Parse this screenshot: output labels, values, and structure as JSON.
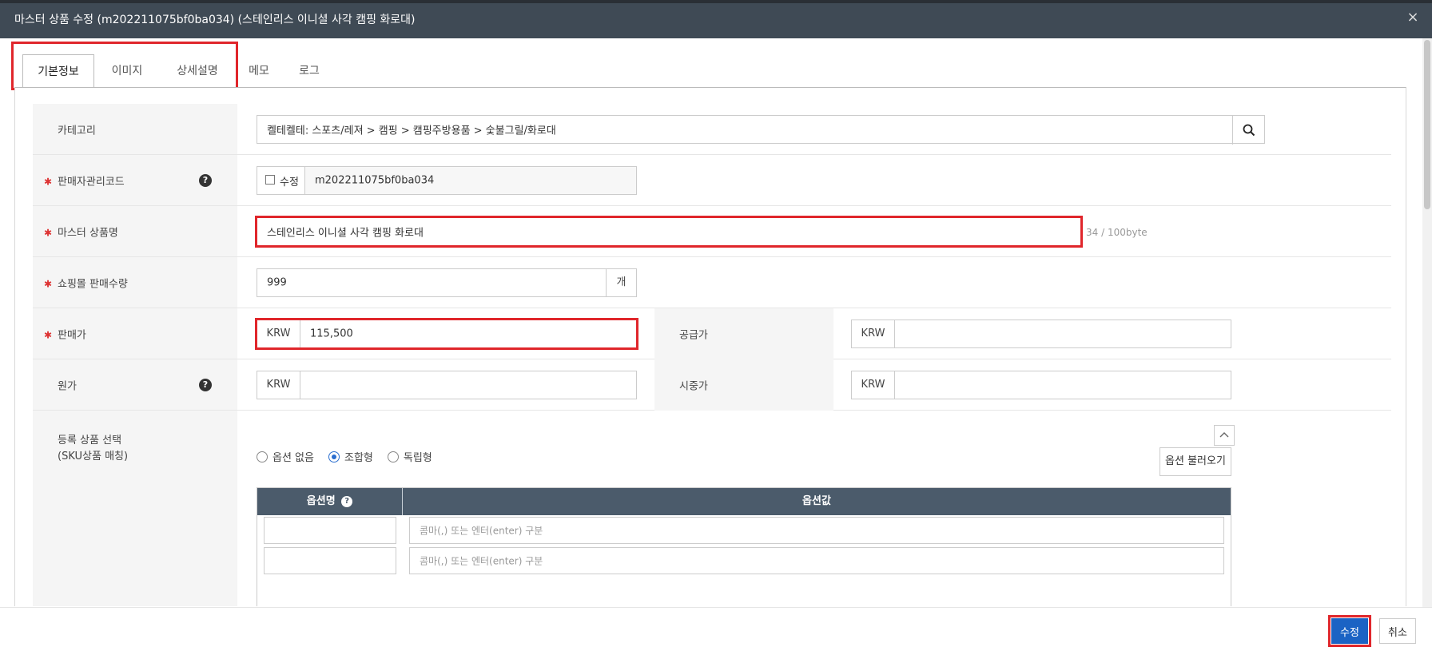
{
  "window": {
    "title": "마스터 상품 수정 (m202211075bf0ba034) (스테인리스 이니셜 사각 캠핑 화로대)",
    "close_label": "×"
  },
  "tabs": [
    {
      "label": "기본정보",
      "active": true
    },
    {
      "label": "이미지",
      "active": false
    },
    {
      "label": "상세설명",
      "active": false
    },
    {
      "label": "메모",
      "active": false
    },
    {
      "label": "로그",
      "active": false
    }
  ],
  "form": {
    "category": {
      "label": "카테고리",
      "value": "켈테켈테: 스포츠/레져 > 캠핑 > 캠핑주방용품 > 숯불그릴/화로대"
    },
    "seller_code": {
      "label": "판매자관리코드",
      "required": true,
      "checkbox_label": "수정",
      "checked": false,
      "value": "m202211075bf0ba034"
    },
    "product_name": {
      "label": "마스터 상품명",
      "required": true,
      "value": "스테인리스 이니셜 사각 캠핑 화로대",
      "byte_counter": "34 / 100byte"
    },
    "sales_quantity": {
      "label": "쇼핑몰 판매수량",
      "required": true,
      "value": "999",
      "unit": "개"
    },
    "sale_price": {
      "label": "판매가",
      "required": true,
      "currency": "KRW",
      "value": "115,500"
    },
    "supply_price": {
      "label": "공급가",
      "currency": "KRW",
      "value": ""
    },
    "cost_price": {
      "label": "원가",
      "currency": "KRW",
      "value": ""
    },
    "market_price": {
      "label": "시중가",
      "currency": "KRW",
      "value": ""
    },
    "sku": {
      "label_line1": "등록 상품 선택",
      "label_line2": "(SKU상품 매칭)",
      "options": [
        {
          "label": "옵션 없음",
          "selected": false
        },
        {
          "label": "조합형",
          "selected": true
        },
        {
          "label": "독립형",
          "selected": false
        }
      ],
      "load_button": "옵션 불러오기",
      "table": {
        "col_name": "옵션명",
        "col_value": "옵션값",
        "placeholder": "콤마(,) 또는 엔터(enter) 구분"
      }
    }
  },
  "help_icon_glyph": "?",
  "footer": {
    "save_label": "수정",
    "cancel_label": "취소"
  },
  "colors": {
    "header_bg": "#3f4a55",
    "highlight_red": "#e0262b",
    "primary_blue": "#1b63c4",
    "table_head_bg": "#4b5b6b"
  }
}
